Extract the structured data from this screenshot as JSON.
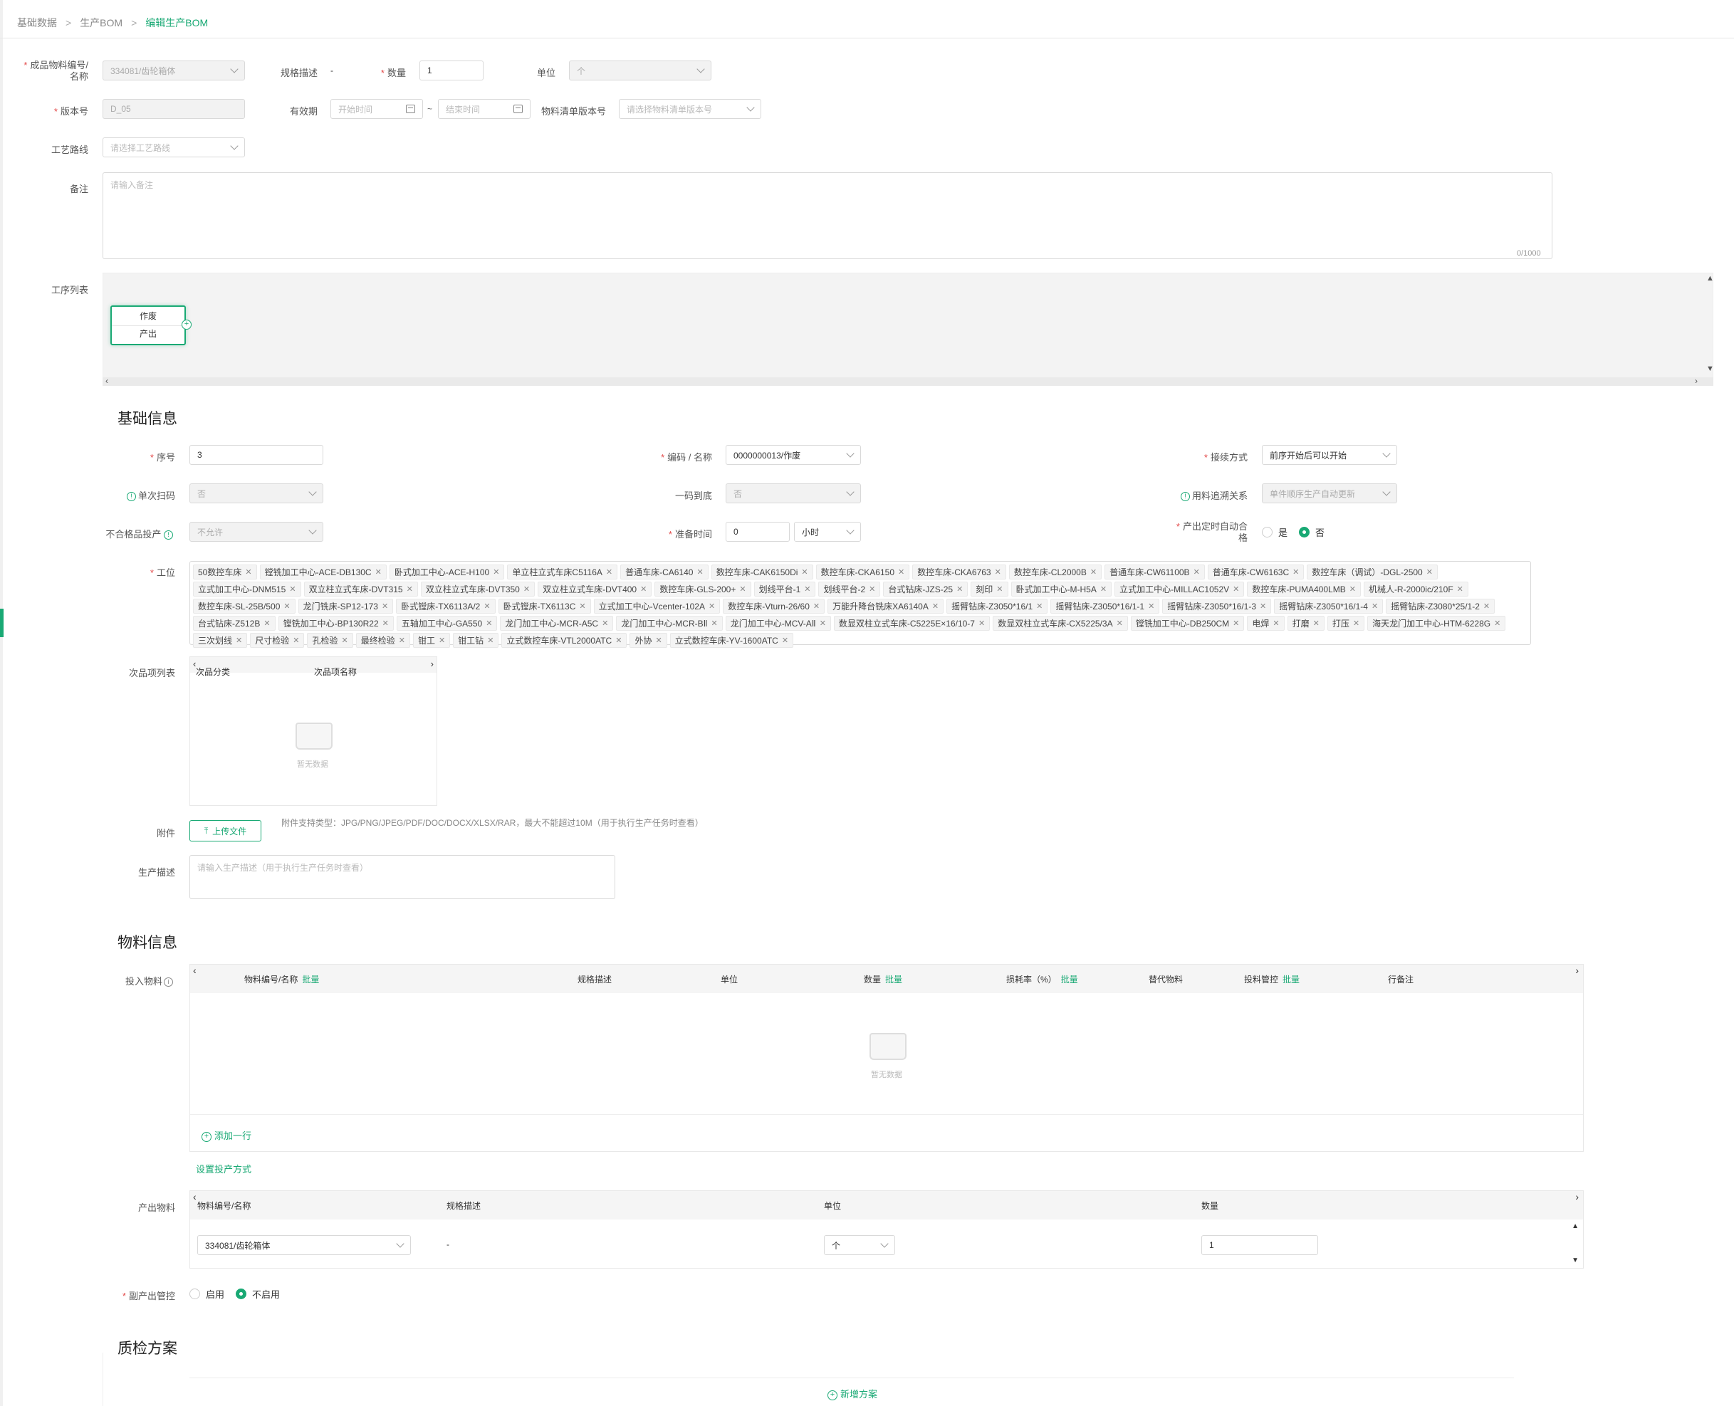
{
  "breadcrumb": {
    "items": [
      "基础数据",
      "生产BOM"
    ],
    "current": "编辑生产BOM",
    "sep": ">"
  },
  "form": {
    "product_label": "成品物料编号/名称",
    "product_value": "334081/齿轮箱体",
    "spec_label": "规格描述",
    "spec_value": "-",
    "qty_label": "数量",
    "qty_value": "1",
    "unit_label": "单位",
    "unit_value": "个",
    "version_label": "版本号",
    "version_value": "D_05",
    "valid_label": "有效期",
    "start_ph": "开始时间",
    "end_ph": "结束时间",
    "range_sep": "~",
    "bom_version_label": "物料清单版本号",
    "bom_version_ph": "请选择物料清单版本号",
    "route_label": "工艺路线",
    "route_ph": "请选择工艺路线",
    "remark_label": "备注",
    "remark_ph": "请输入备注",
    "remark_count": "0/1000",
    "process_list_label": "工序列表"
  },
  "flow": {
    "node_title": "作废",
    "node_sub": "产出"
  },
  "basic": {
    "title": "基础信息",
    "seq_label": "序号",
    "seq_value": "3",
    "code_label": "编码 / 名称",
    "code_value": "0000000013/作废",
    "connect_label": "接续方式",
    "connect_value": "前序开始后可以开始",
    "single_scan_label": "单次扫码",
    "single_scan_value": "否",
    "one_code_label": "一码到底",
    "one_code_value": "否",
    "trace_label": "用料追溯关系",
    "trace_value": "单件顺序生产自动更新",
    "reject_label": "不合格品投产",
    "reject_value": "不允许",
    "prep_label": "准备时间",
    "prep_value": "0",
    "prep_unit": "小时",
    "auto_label": "产出定时自动合格",
    "auto_yes": "是",
    "auto_no": "否",
    "station_label": "工位",
    "stations": [
      "50数控车床",
      "镗铣加工中心-ACE-DB130C",
      "卧式加工中心-ACE-H100",
      "单立柱立式车床C5116A",
      "普通车床-CA6140",
      "数控车床-CAK6150Di",
      "数控车床-CKA6150",
      "数控车床-CKA6763",
      "数控车床-CL2000B",
      "普通车床-CW61100B",
      "普通车床-CW6163C",
      "数控车床（调试）-DGL-2500",
      "立式加工中心-DNM515",
      "双立柱立式车床-DVT315",
      "双立柱立式车床-DVT350",
      "双立柱立式车床-DVT400",
      "数控车床-GLS-200+",
      "划线平台-1",
      "划线平台-2",
      "台式钻床-JZS-25",
      "刻印",
      "卧式加工中心-M-H5A",
      "立式加工中心-MILLAC1052V",
      "数控车床-PUMA400LMB",
      "机械人-R-2000ic/210F",
      "数控车床-SL-25B/500",
      "龙门铣床-SP12-173",
      "卧式镗床-TX6113A/2",
      "卧式镗床-TX6113C",
      "立式加工中心-Vcenter-102A",
      "数控车床-Vturn-26/60",
      "万能升降台铣床XA6140A",
      "摇臂钻床-Z3050*16/1",
      "摇臂钻床-Z3050*16/1-1",
      "摇臂钻床-Z3050*16/1-3",
      "摇臂钻床-Z3050*16/1-4",
      "摇臂钻床-Z3080*25/1-2",
      "台式钻床-Z512B",
      "镗铣加工中心-BP130R22",
      "五轴加工中心-GA550",
      "龙门加工中心-MCR-A5C",
      "龙门加工中心-MCR-BⅡ",
      "龙门加工中心-MCV-AⅡ",
      "数显双柱立式车床-C5225E×16/10-7",
      "数显双柱立式车床-CX5225/3A",
      "镗铣加工中心-DB250CM",
      "电焊",
      "打磨",
      "打压",
      "海天龙门加工中心-HTM-6228G",
      "三次划线",
      "尺寸检验",
      "孔检验",
      "最终检验",
      "钳工",
      "钳工钻",
      "立式数控车床-VTL2000ATC",
      "外协",
      "立式数控车床-YV-1600ATC"
    ],
    "defect_label": "次品项列表",
    "defect_cols": [
      "次品分类",
      "次品项名称"
    ],
    "empty_text": "暂无数据",
    "attach_label": "附件",
    "upload_label": "上传文件",
    "attach_hint": "附件支持类型：JPG/PNG/JPEG/PDF/DOC/DOCX/XLSX/RAR，最大不能超过10M（用于执行生产任务时查看）",
    "desc_label": "生产描述",
    "desc_ph": "请输入生产描述（用于执行生产任务时查看）"
  },
  "material": {
    "title": "物料信息",
    "input_label": "投入物料",
    "input_cols": {
      "c1": "物料编号/名称",
      "c2": "规格描述",
      "c3": "单位",
      "c4": "数量",
      "c5": "损耗率（%）",
      "c6": "替代物料",
      "c7": "投料管控",
      "c8": "行备注",
      "batch": "批量"
    },
    "empty_text": "暂无数据",
    "add_row": "添加一行",
    "set_mode": "设置投产方式",
    "output_label": "产出物料",
    "output_cols": {
      "c1": "物料编号/名称",
      "c2": "规格描述",
      "c3": "单位",
      "c4": "数量"
    },
    "output_row": {
      "material": "334081/齿轮箱体",
      "spec": "-",
      "unit": "个",
      "qty": "1"
    },
    "byproduct_label": "副产出管控",
    "enable": "启用",
    "disable": "不启用"
  },
  "quality": {
    "title": "质检方案",
    "add": "新增方案"
  },
  "colors": {
    "accent": "#19a974",
    "required": "#e34b4b"
  }
}
